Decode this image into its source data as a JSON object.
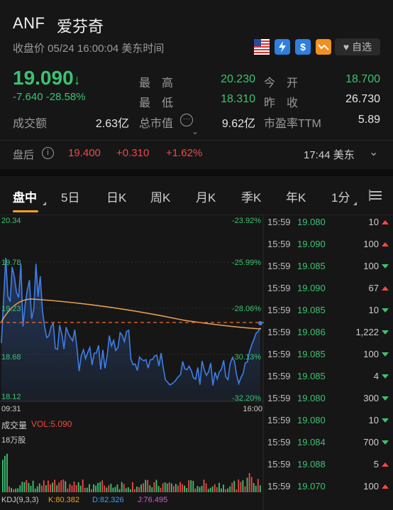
{
  "header": {
    "ticker": "ANF",
    "name": "爱芬奇",
    "status": "收盘价 05/24 16:00:04 美东时间",
    "fav_label": "自选"
  },
  "quote": {
    "price": "19.090",
    "change": "-7.640",
    "change_pct": "-28.58%",
    "high_label": "最　高",
    "high": "20.230",
    "open_label": "今　开",
    "open": "18.700",
    "low_label": "最　低",
    "low": "18.310",
    "prev_label": "昨　收",
    "prev": "26.730",
    "turnover_label": "成交额",
    "turnover": "2.63亿",
    "mktcap_label": "总市值",
    "mktcap": "9.62亿",
    "pe_label": "市盈率TTM",
    "pe": "5.89"
  },
  "after_hours": {
    "label": "盘后",
    "price": "19.400",
    "change": "+0.310",
    "change_pct": "+1.62%",
    "time": "17:44 美东"
  },
  "tabs": [
    "盘中",
    "5日",
    "日K",
    "周K",
    "月K",
    "季K",
    "年K",
    "1分"
  ],
  "chart": {
    "y_left": [
      "20.34",
      "19.78",
      "19.23",
      "18.68",
      "18.12"
    ],
    "y_right": [
      "-23.92%",
      "-25.99%",
      "-28.06%",
      "-30.13%",
      "-32.20%"
    ],
    "x_start": "09:31",
    "x_end": "16:00",
    "vol_label": "成交量",
    "vol_value": "VOL:5.090",
    "vol_scale": "18万股",
    "kdj_label": "KDJ(9,3,3)",
    "kdj_k": "K:80.382",
    "kdj_d": "D:82.326",
    "kdj_j": "J:76.495"
  },
  "trades": [
    {
      "time": "15:59",
      "price": "19.080",
      "vol": "10",
      "dir": "up",
      "pcolor": "green"
    },
    {
      "time": "15:59",
      "price": "19.090",
      "vol": "100",
      "dir": "up",
      "pcolor": "green",
      "vcolor": "red"
    },
    {
      "time": "15:59",
      "price": "19.085",
      "vol": "100",
      "dir": "dn",
      "pcolor": "green"
    },
    {
      "time": "15:59",
      "price": "19.090",
      "vol": "67",
      "dir": "up",
      "pcolor": "green",
      "vcolor": "red"
    },
    {
      "time": "15:59",
      "price": "19.085",
      "vol": "10",
      "dir": "dn",
      "pcolor": "green"
    },
    {
      "time": "15:59",
      "price": "19.086",
      "vol": "1,222",
      "dir": "dn",
      "pcolor": "green"
    },
    {
      "time": "15:59",
      "price": "19.085",
      "vol": "100",
      "dir": "dn",
      "pcolor": "green"
    },
    {
      "time": "15:59",
      "price": "19.085",
      "vol": "4",
      "dir": "dn",
      "pcolor": "green"
    },
    {
      "time": "15:59",
      "price": "19.080",
      "vol": "300",
      "dir": "dn",
      "pcolor": "green"
    },
    {
      "time": "15:59",
      "price": "19.080",
      "vol": "10",
      "dir": "dn",
      "pcolor": "green"
    },
    {
      "time": "15:59",
      "price": "19.084",
      "vol": "700",
      "dir": "dn",
      "pcolor": "green"
    },
    {
      "time": "15:59",
      "price": "19.088",
      "vol": "5",
      "dir": "up",
      "pcolor": "green"
    },
    {
      "time": "15:59",
      "price": "19.070",
      "vol": "100",
      "dir": "up",
      "pcolor": "green",
      "vcolor": "red"
    }
  ],
  "colors": {
    "up": "#f04848",
    "down": "#3cc271",
    "avg_line": "#e8a050",
    "price_line": "#3f7ee8"
  }
}
